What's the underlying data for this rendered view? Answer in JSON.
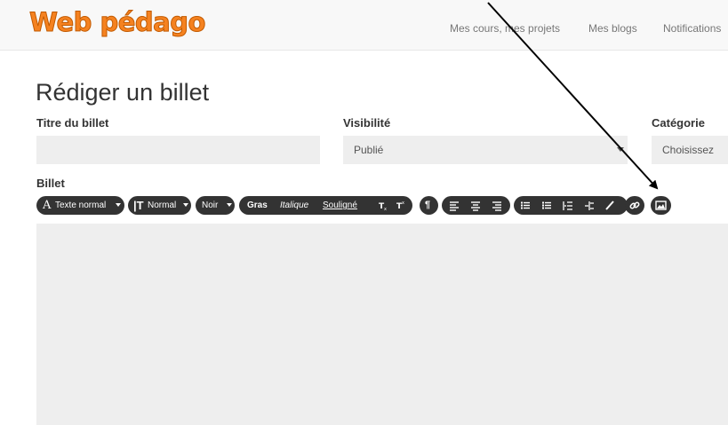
{
  "header": {
    "logo": "Web pédago",
    "nav": [
      "Mes cours, mes projets",
      "Mes blogs",
      "Notifications"
    ]
  },
  "page": {
    "title": "Rédiger un billet"
  },
  "form": {
    "title_label": "Titre du billet",
    "title_value": "",
    "visibility_label": "Visibilité",
    "visibility_value": "Publié",
    "category_label": "Catégorie",
    "category_value": "Choisissez",
    "body_label": "Billet"
  },
  "toolbar": {
    "font_family": "Texte normal",
    "font_size": "Normal",
    "color": "Noir",
    "bold": "Gras",
    "italic": "Italique",
    "underline": "Souligné"
  },
  "icons": [
    "font-family-icon",
    "text-size-icon",
    "subscript-icon",
    "superscript-icon",
    "paragraph-icon",
    "align-left-icon",
    "align-center-icon",
    "align-right-icon",
    "bullet-list-icon",
    "numbered-list-icon",
    "indent-icon",
    "outdent-icon",
    "pencil-icon",
    "link-icon",
    "image-icon"
  ],
  "colors": {
    "accent": "#f58220",
    "toolbar": "#333333",
    "field_bg": "#eeeeee"
  }
}
